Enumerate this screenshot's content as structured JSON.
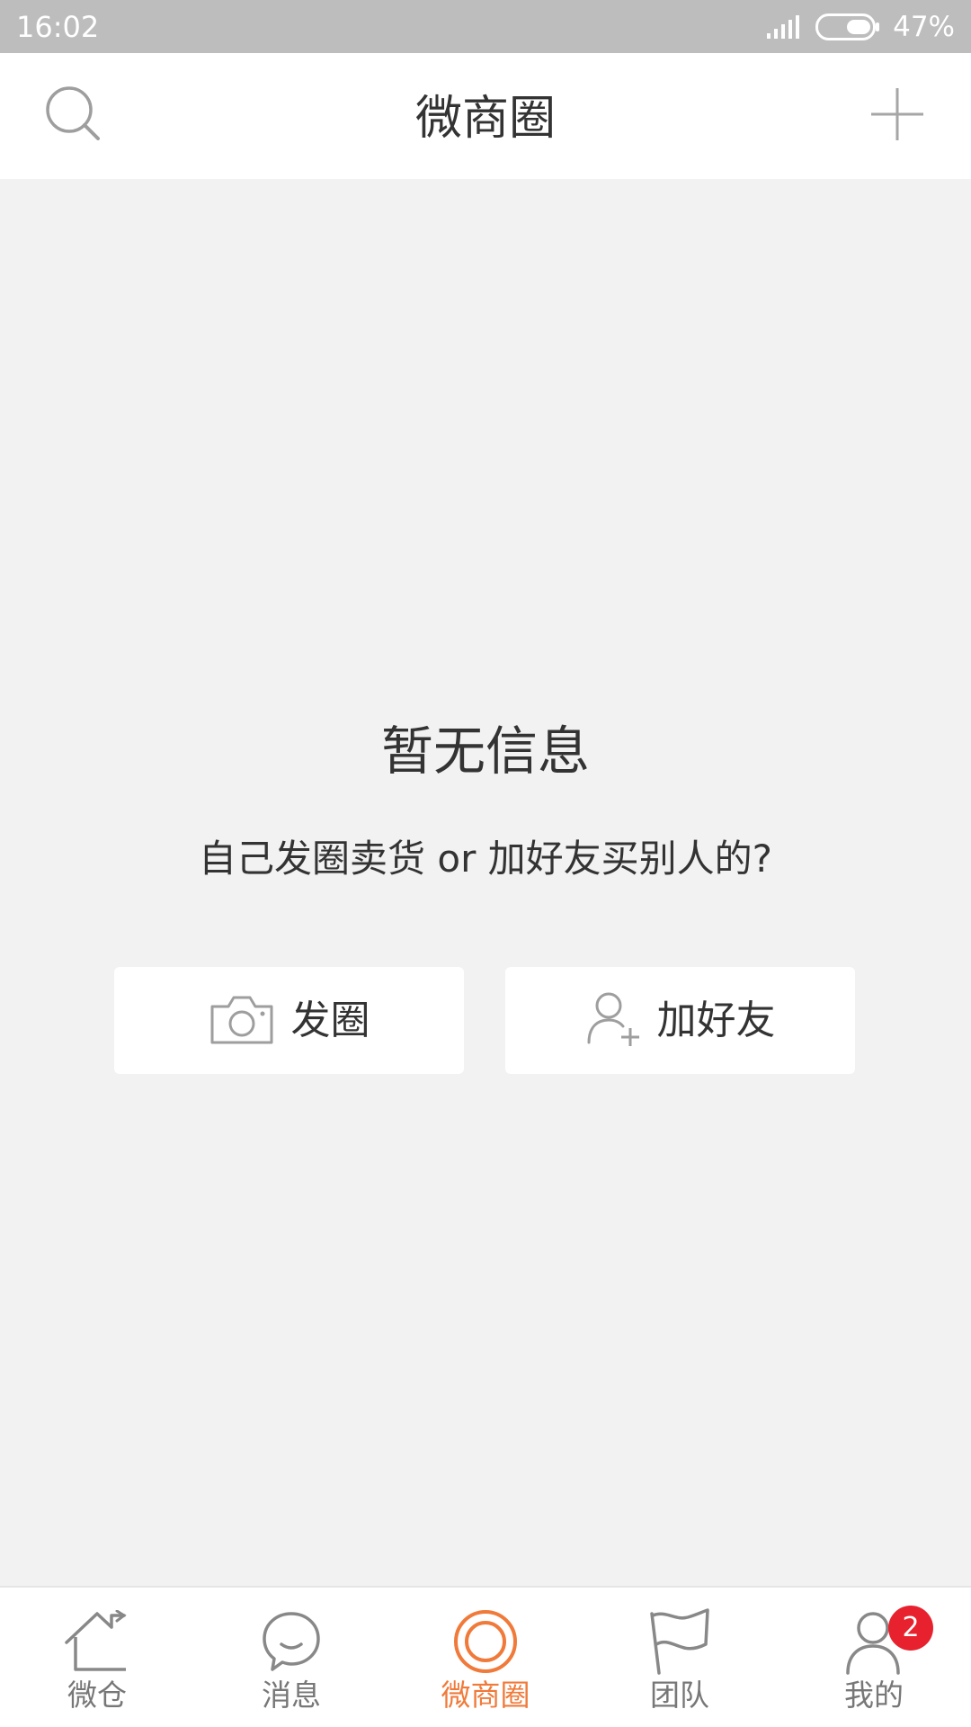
{
  "status_bar": {
    "time": "16:02",
    "battery_percent": "47%",
    "battery_level": 0.47
  },
  "header": {
    "title": "微商圈",
    "left_icon": "search-icon",
    "right_icon": "plus-icon"
  },
  "empty_state": {
    "title": "暂无信息",
    "subtitle": "自己发圈卖货 or 加好友买别人的?"
  },
  "actions": [
    {
      "label": "发圈",
      "icon": "camera-icon"
    },
    {
      "label": "加好友",
      "icon": "add-user-icon"
    }
  ],
  "tabs": [
    {
      "label": "微仓",
      "icon": "home-icon",
      "active": false
    },
    {
      "label": "消息",
      "icon": "chat-bubble-icon",
      "active": false
    },
    {
      "label": "微商圈",
      "icon": "circle-icon",
      "active": true
    },
    {
      "label": "团队",
      "icon": "flag-icon",
      "active": false
    },
    {
      "label": "我的",
      "icon": "user-icon",
      "active": false,
      "badge": "2"
    }
  ],
  "colors": {
    "accent": "#f07a3a",
    "badge": "#e7222e",
    "background": "#f2f2f2",
    "status_bar": "#bdbdbd"
  }
}
